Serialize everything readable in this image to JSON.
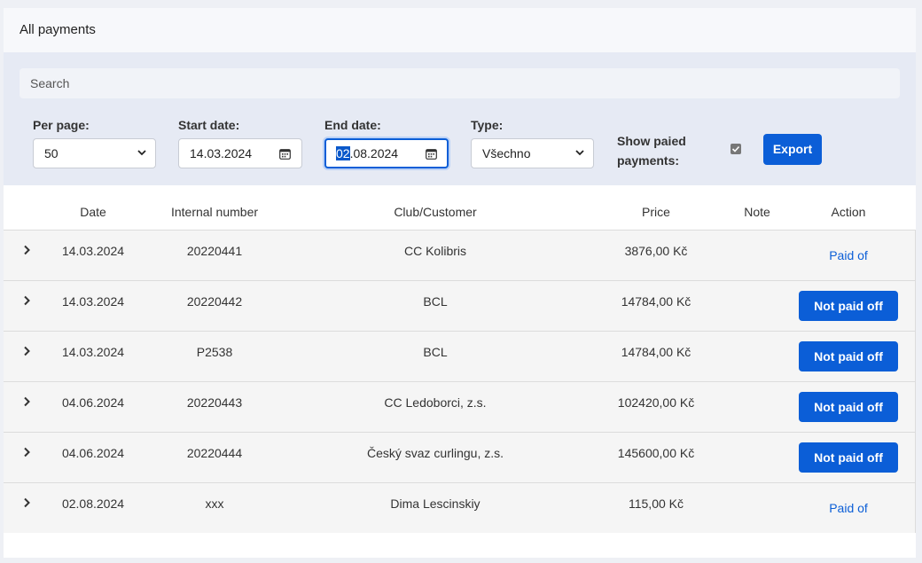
{
  "header": {
    "title": "All payments"
  },
  "filters": {
    "search_placeholder": "Search",
    "per_page": {
      "label": "Per page:",
      "value": "50"
    },
    "start_date": {
      "label": "Start date:",
      "value": "14.03.2024"
    },
    "end_date": {
      "label": "End date:",
      "value_selected": "02",
      "value_rest": ".08.2024"
    },
    "type": {
      "label": "Type:",
      "value": "Všechno"
    },
    "show_paid": {
      "label_line1": "Show paied",
      "label_line2": "payments:",
      "checked": true
    },
    "export_label": "Export"
  },
  "table": {
    "columns": [
      "Date",
      "Internal number",
      "Club/Customer",
      "Price",
      "Note",
      "Action"
    ],
    "rows": [
      {
        "date": "14.03.2024",
        "internal_number": "20220441",
        "customer": "CC Kolibris",
        "price": "3876,00 Kč",
        "note": "",
        "action": "Paid of",
        "action_type": "link"
      },
      {
        "date": "14.03.2024",
        "internal_number": "20220442",
        "customer": "BCL",
        "price": "14784,00 Kč",
        "note": "",
        "action": "Not paid off",
        "action_type": "button"
      },
      {
        "date": "14.03.2024",
        "internal_number": "P2538",
        "customer": "BCL",
        "price": "14784,00 Kč",
        "note": "",
        "action": "Not paid off",
        "action_type": "button"
      },
      {
        "date": "04.06.2024",
        "internal_number": "20220443",
        "customer": "CC Ledoborci, z.s.",
        "price": "102420,00 Kč",
        "note": "",
        "action": "Not paid off",
        "action_type": "button"
      },
      {
        "date": "04.06.2024",
        "internal_number": "20220444",
        "customer": "Český svaz curlingu, z.s.",
        "price": "145600,00 Kč",
        "note": "",
        "action": "Not paid off",
        "action_type": "button"
      },
      {
        "date": "02.08.2024",
        "internal_number": "xxx",
        "customer": "Dima Lescinskiy",
        "price": "115,00 Kč",
        "note": "",
        "action": "Paid of",
        "action_type": "link"
      }
    ]
  },
  "colors": {
    "primary": "#0b5ed7",
    "filter_bg": "#e6eaf4",
    "row_bg": "#f5f5f5"
  }
}
